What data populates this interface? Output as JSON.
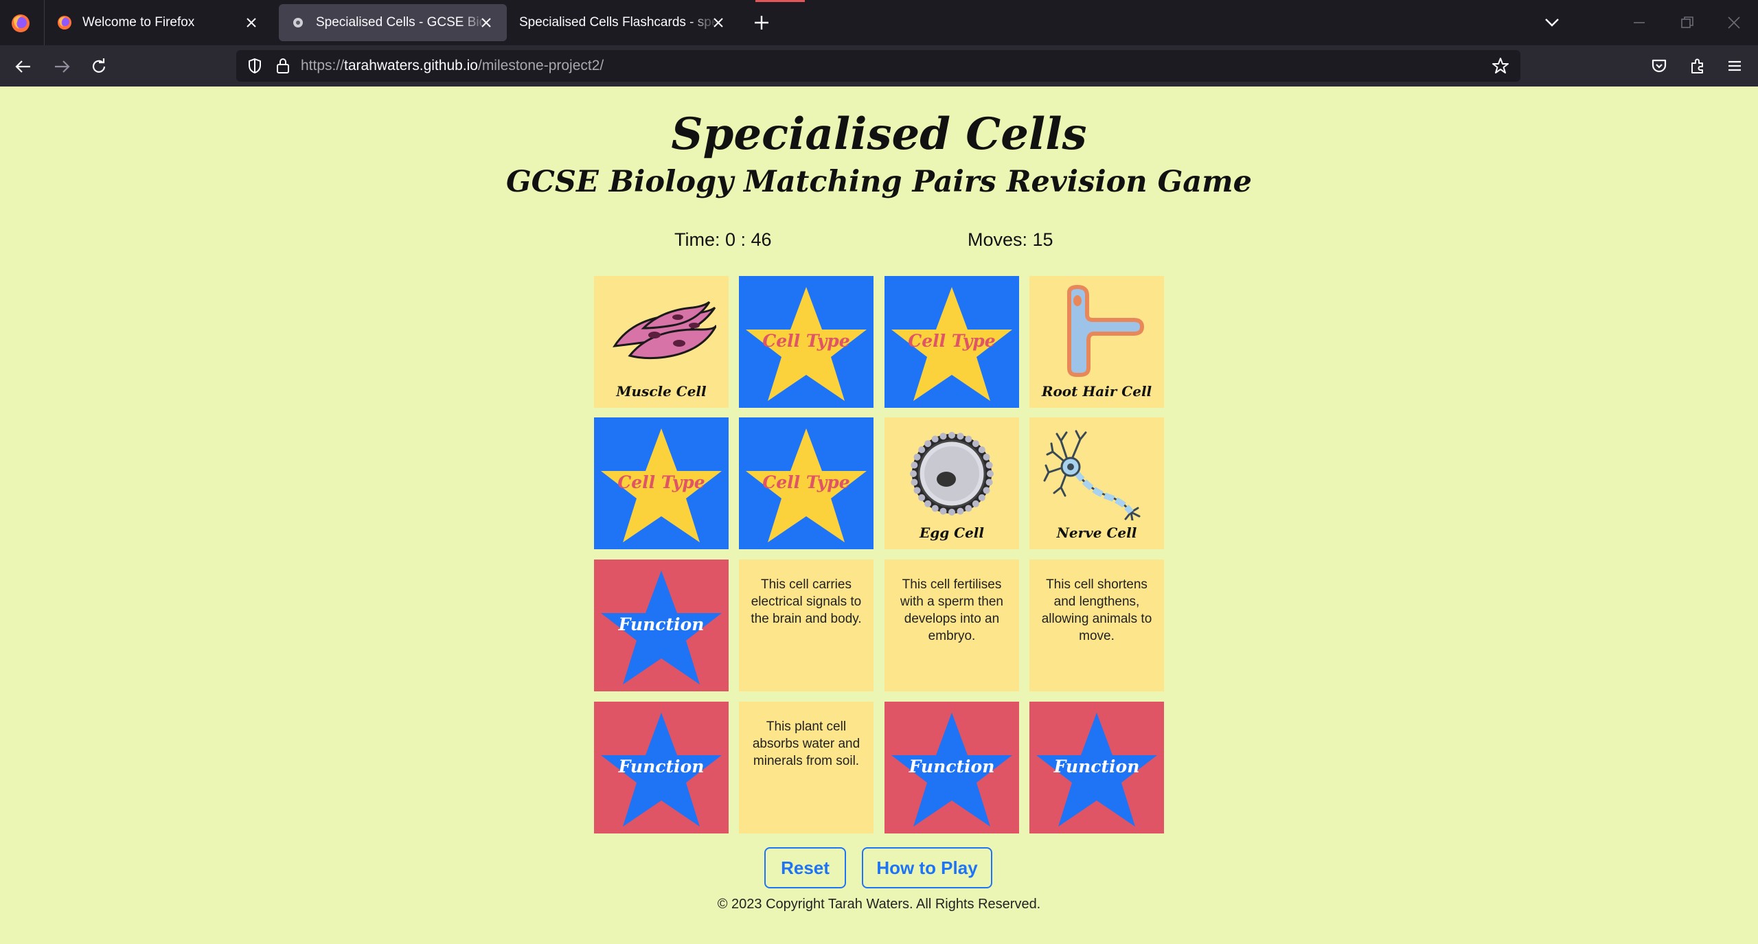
{
  "browser": {
    "tabs": [
      {
        "title": "Welcome to Firefox",
        "active": false
      },
      {
        "title": "Specialised Cells - GCSE Biology",
        "active": true
      },
      {
        "title": "Specialised Cells Flashcards - specialised",
        "active": false
      }
    ],
    "url": {
      "prefix": "https://",
      "domain": "tarahwaters.github.io",
      "path": "/milestone-project2/"
    },
    "colors": {
      "chrome": "#1c1b22",
      "toolbar": "#2b2a33",
      "active_tab": "#42414d"
    }
  },
  "game": {
    "title": "Specialised Cells",
    "subtitle": "GCSE Biology Matching Pairs Revision Game",
    "time": "Time: 0 : 46",
    "moves": "Moves: 15",
    "cards": [
      {
        "kind": "image",
        "label": "Muscle Cell",
        "icon": "muscle-cell-icon"
      },
      {
        "kind": "back",
        "label": "Cell Type",
        "back_color": "#1e74f5",
        "star_color": "#fbd13c"
      },
      {
        "kind": "back",
        "label": "Cell Type",
        "back_color": "#1e74f5",
        "star_color": "#fbd13c"
      },
      {
        "kind": "image",
        "label": "Root Hair Cell",
        "icon": "root-hair-cell-icon"
      },
      {
        "kind": "back",
        "label": "Cell Type",
        "back_color": "#1e74f5",
        "star_color": "#fbd13c"
      },
      {
        "kind": "back",
        "label": "Cell Type",
        "back_color": "#1e74f5",
        "star_color": "#fbd13c"
      },
      {
        "kind": "image",
        "label": "Egg Cell",
        "icon": "egg-cell-icon"
      },
      {
        "kind": "image",
        "label": "Nerve Cell",
        "icon": "nerve-cell-icon"
      },
      {
        "kind": "back",
        "label": "Function",
        "back_color": "#df5565",
        "star_color": "#1e74f5"
      },
      {
        "kind": "text",
        "text": "This cell carries electrical signals to the brain and body."
      },
      {
        "kind": "text",
        "text": "This cell fertilises with a sperm then develops into an embryo."
      },
      {
        "kind": "text",
        "text": "This cell shortens and lengthens, allowing animals to move."
      },
      {
        "kind": "back",
        "label": "Function",
        "back_color": "#df5565",
        "star_color": "#1e74f5"
      },
      {
        "kind": "text",
        "text": "This plant cell absorbs water and minerals from soil."
      },
      {
        "kind": "back",
        "label": "Function",
        "back_color": "#df5565",
        "star_color": "#1e74f5"
      },
      {
        "kind": "back",
        "label": "Function",
        "back_color": "#df5565",
        "star_color": "#1e74f5"
      }
    ],
    "buttons": {
      "reset": "Reset",
      "how_to_play": "How to Play"
    },
    "footer": "© 2023 Copyright Tarah Waters. All Rights Reserved.",
    "colors": {
      "page_bg": "#ecf6b4",
      "card_face": "#fde58c",
      "accent_blue": "#1e74f5",
      "accent_red": "#df5565"
    }
  }
}
